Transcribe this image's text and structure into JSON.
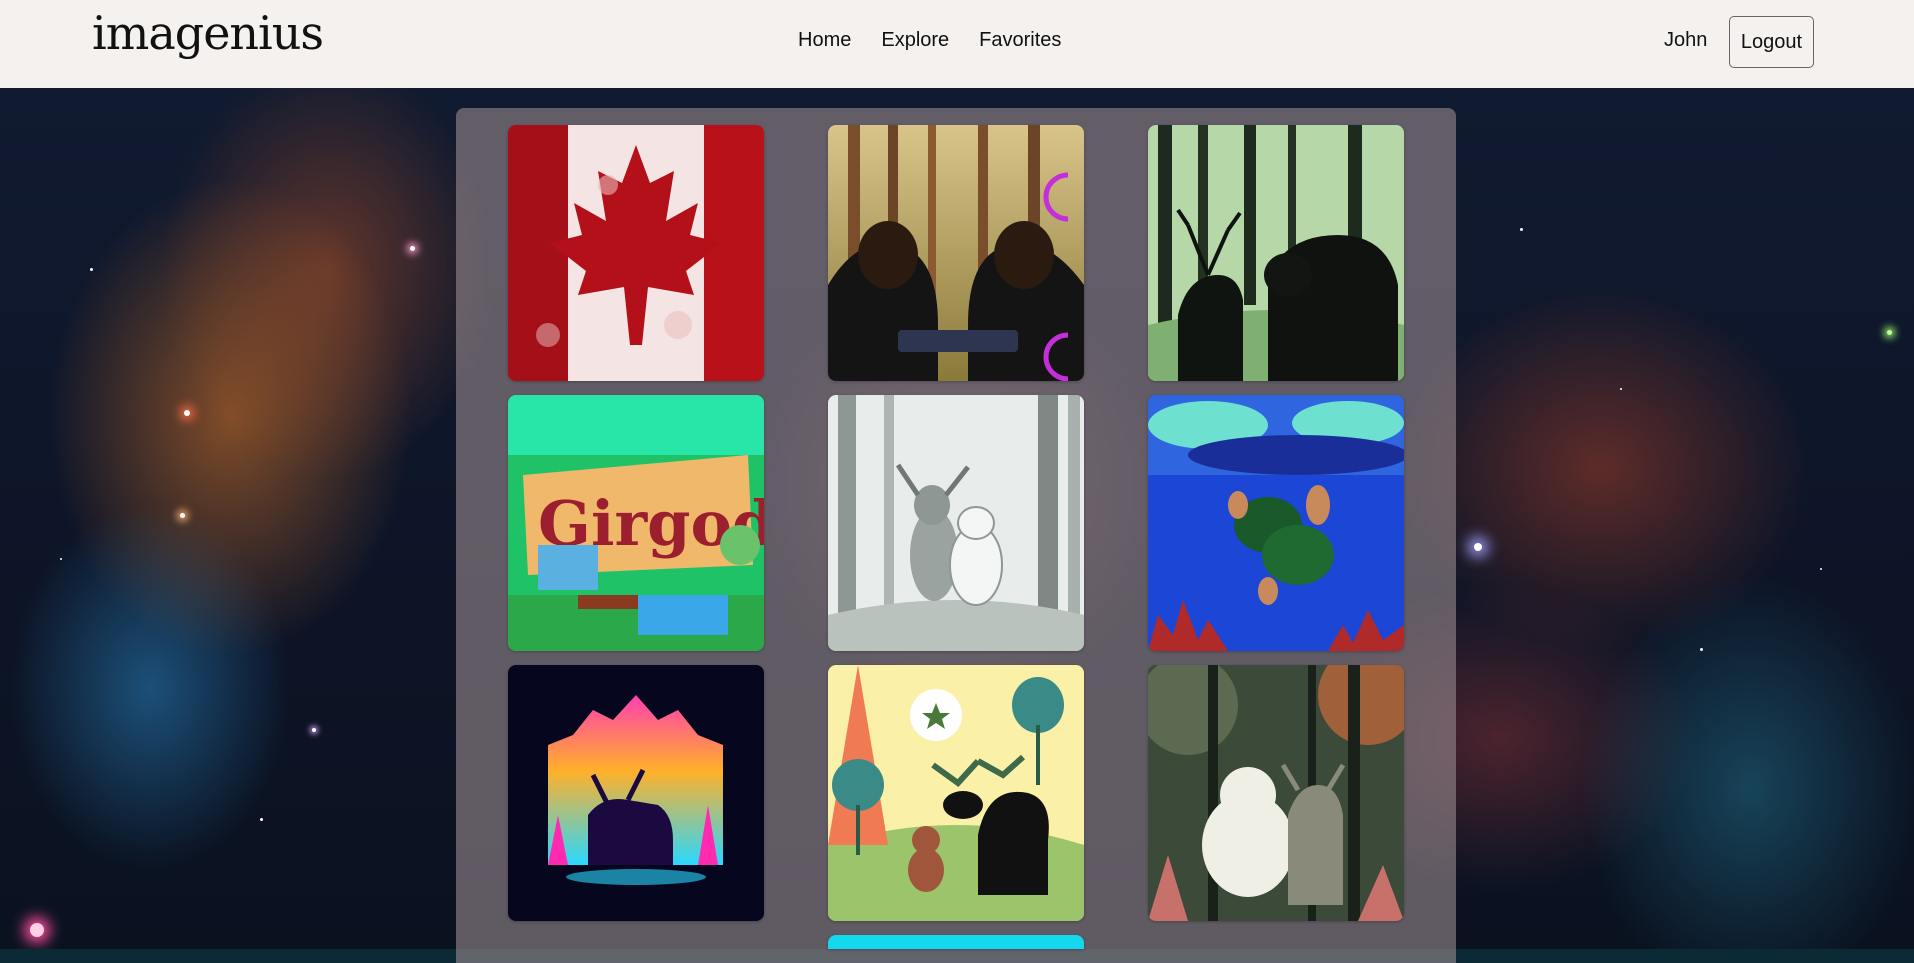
{
  "header": {
    "logo": "imagenius",
    "nav": [
      {
        "label": "Home"
      },
      {
        "label": "Explore"
      },
      {
        "label": "Favorites"
      }
    ],
    "user": "John",
    "logout_label": "Logout"
  },
  "gallery": {
    "tiles": [
      {
        "subject": "canadian-flag"
      },
      {
        "subject": "two-people-at-keyboard-in-forest"
      },
      {
        "subject": "moose-and-bear-in-forest"
      },
      {
        "subject": "girgodo-sign-cartoon"
      },
      {
        "subject": "sketch-moose-and-bear"
      },
      {
        "subject": "sea-turtles"
      },
      {
        "subject": "neon-moose-forest"
      },
      {
        "subject": "cartoon-moose-and-bear"
      },
      {
        "subject": "bear-and-moose-dark-forest"
      },
      {
        "subject": "partial-cyan-tile"
      }
    ]
  },
  "colors": {
    "header_bg": "#f4f1ef",
    "panel_bg": "rgba(150,135,140,0.62)"
  }
}
